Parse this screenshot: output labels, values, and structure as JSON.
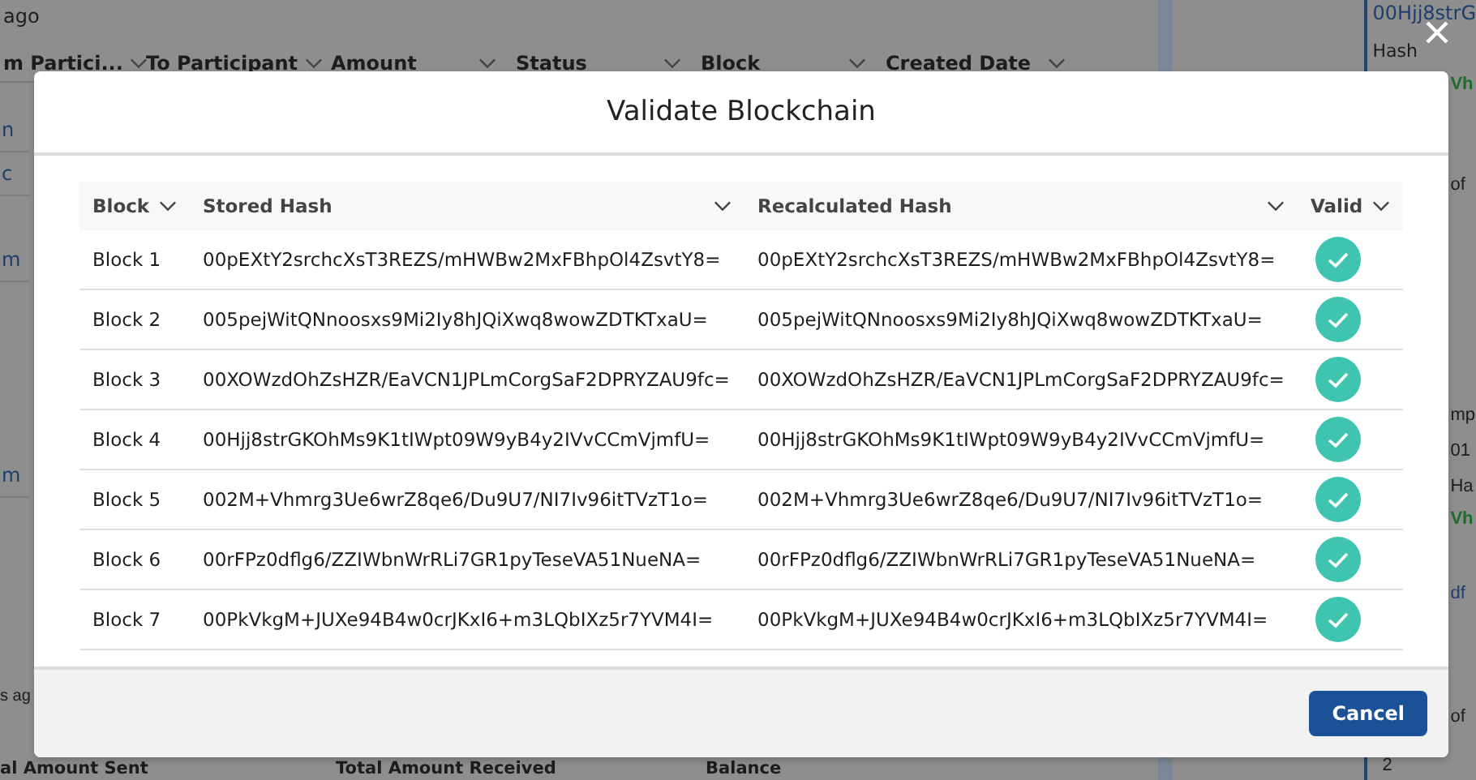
{
  "background": {
    "top_text": "ago",
    "columns": [
      {
        "label": "m Partici...",
        "sorted": false
      },
      {
        "label": "To Participant",
        "sorted": false
      },
      {
        "label": "Amount",
        "sorted": false
      },
      {
        "label": "Status",
        "sorted": false
      },
      {
        "label": "Block",
        "sorted": false
      },
      {
        "label": "Created Date",
        "sorted": true
      }
    ],
    "left_links": [
      "n",
      "c",
      "m",
      "m"
    ],
    "bottom_time": "s ag",
    "summary_columns": [
      "al Amount Sent",
      "Total Amount Received",
      "Balance"
    ],
    "side_panel": [
      {
        "kind": "link",
        "text": "00Hjj8strG"
      },
      {
        "kind": "label",
        "text": "Hash"
      },
      {
        "kind": "green",
        "text": "Vh"
      },
      {
        "kind": "label",
        "text": "of"
      },
      {
        "kind": "label",
        "text": "mp"
      },
      {
        "kind": "value",
        "text": "01"
      },
      {
        "kind": "label",
        "text": "Ha"
      },
      {
        "kind": "green",
        "text": "Vh"
      },
      {
        "kind": "link",
        "text": "df"
      },
      {
        "kind": "label",
        "text": "of"
      },
      {
        "kind": "value",
        "text": "2"
      }
    ]
  },
  "modal": {
    "title": "Validate Blockchain",
    "table": {
      "columns": [
        "Block",
        "Stored Hash",
        "Recalculated Hash",
        "Valid"
      ],
      "rows": [
        {
          "block": "Block 1",
          "stored_hash": "00pEXtY2srchcXsT3REZS/mHWBw2MxFBhpOl4ZsvtY8=",
          "recalculated_hash": "00pEXtY2srchcXsT3REZS/mHWBw2MxFBhpOl4ZsvtY8=",
          "valid": true
        },
        {
          "block": "Block 2",
          "stored_hash": "005pejWitQNnoosxs9Mi2Iy8hJQiXwq8wowZDTKTxaU=",
          "recalculated_hash": "005pejWitQNnoosxs9Mi2Iy8hJQiXwq8wowZDTKTxaU=",
          "valid": true
        },
        {
          "block": "Block 3",
          "stored_hash": "00XOWzdOhZsHZR/EaVCN1JPLmCorgSaF2DPRYZAU9fc=",
          "recalculated_hash": "00XOWzdOhZsHZR/EaVCN1JPLmCorgSaF2DPRYZAU9fc=",
          "valid": true
        },
        {
          "block": "Block 4",
          "stored_hash": "00Hjj8strGKOhMs9K1tIWpt09W9yB4y2IVvCCmVjmfU=",
          "recalculated_hash": "00Hjj8strGKOhMs9K1tIWpt09W9yB4y2IVvCCmVjmfU=",
          "valid": true
        },
        {
          "block": "Block 5",
          "stored_hash": "002M+Vhmrg3Ue6wrZ8qe6/Du9U7/NI7Iv96itTVzT1o=",
          "recalculated_hash": "002M+Vhmrg3Ue6wrZ8qe6/Du9U7/NI7Iv96itTVzT1o=",
          "valid": true
        },
        {
          "block": "Block 6",
          "stored_hash": "00rFPz0dflg6/ZZIWbnWrRLi7GR1pyTeseVA51NueNA=",
          "recalculated_hash": "00rFPz0dflg6/ZZIWbnWrRLi7GR1pyTeseVA51NueNA=",
          "valid": true
        },
        {
          "block": "Block 7",
          "stored_hash": "00PkVkgM+JUXe94B4w0crJKxI6+m3LQbIXz5r7YVM4I=",
          "recalculated_hash": "00PkVkgM+JUXe94B4w0crJKxI6+m3LQbIXz5r7YVM4I=",
          "valid": true
        }
      ]
    },
    "buttons": [
      {
        "label": "Cancel"
      }
    ]
  }
}
